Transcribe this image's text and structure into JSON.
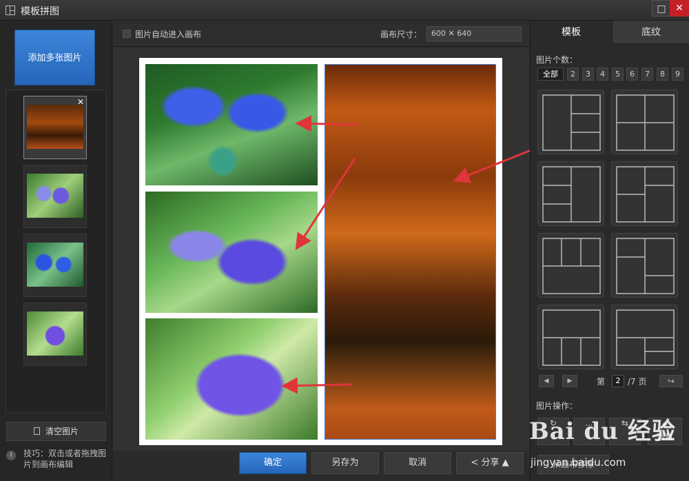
{
  "window": {
    "title": "模板拼图"
  },
  "left": {
    "add_label": "添加多张图片",
    "clear_label": "清空图片",
    "tip": "技巧：双击或者拖拽图片到画布编辑",
    "tip_icon": "i"
  },
  "canvas": {
    "auto_label": "图片自动进入画布",
    "size_label": "画布尺寸：",
    "size_value": "600 ✕ 640"
  },
  "bottom": {
    "ok": "确定",
    "saveas": "另存为",
    "cancel": "取消",
    "share": "分享"
  },
  "right": {
    "tab_template": "模板",
    "tab_background": "底纹",
    "count_label": "图片个数：",
    "counts": [
      "全部",
      "2",
      "3",
      "4",
      "5",
      "6",
      "7",
      "8",
      "9"
    ],
    "page_prefix": "第",
    "page_current": "2",
    "page_suffix": "/7 页",
    "ops_label": "图片操作：",
    "op_a": "...",
    "op_vertical": "竖直",
    "remove": "从画布移除"
  },
  "watermark": {
    "logo": "Bai du 经验",
    "url": "jingyan.baidu.com"
  },
  "colors": {
    "accent": "#2f74cc",
    "close": "#c42127",
    "arrow": "#e0353a"
  },
  "icons": [
    "layout-icon",
    "maximize-icon",
    "close-icon",
    "trash-icon",
    "info-icon",
    "share-icon",
    "undo-icon"
  ]
}
